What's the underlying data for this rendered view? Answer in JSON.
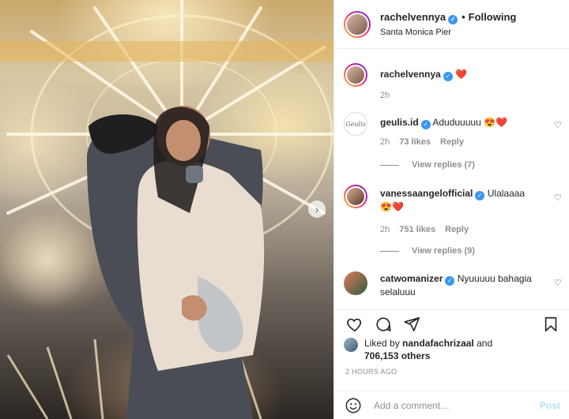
{
  "header": {
    "username": "rachelvennya",
    "separator": "•",
    "follow_state": "Following",
    "location": "Santa Monica Pier"
  },
  "caption": {
    "username": "rachelvennya",
    "text": "❤️",
    "time": "2h"
  },
  "comments": [
    {
      "username": "geulis.id",
      "text": "Aduduuuuu 😍❤️",
      "time": "2h",
      "likes": "73 likes",
      "reply_label": "Reply",
      "view_replies": "View replies (7)"
    },
    {
      "username": "vanessaangelofficial",
      "text": "Ulalaaaa 😍❤️",
      "time": "2h",
      "likes": "751 likes",
      "reply_label": "Reply",
      "view_replies": "View replies (9)"
    },
    {
      "username": "catwomanizer",
      "text": "Nyuuuuu bahagia selaluuu"
    }
  ],
  "likes": {
    "prefix": "Liked by",
    "first_liker": "nandafachrizaal",
    "conjunction": "and",
    "others": "706,153 others"
  },
  "timestamp": "2 HOURS AGO",
  "add_comment": {
    "placeholder": "Add a comment…",
    "post_label": "Post"
  },
  "media": {
    "next_glyph": "›"
  },
  "icons": {
    "like": "heart-icon",
    "comment": "comment-icon",
    "share": "paper-plane-icon",
    "save": "bookmark-icon",
    "emoji": "emoji-icon",
    "next": "chevron-right-icon"
  },
  "colors": {
    "verified": "#3897f0",
    "heart": "#ed4956",
    "post_button": "#b2dffc",
    "muted": "#8e8e8e"
  }
}
